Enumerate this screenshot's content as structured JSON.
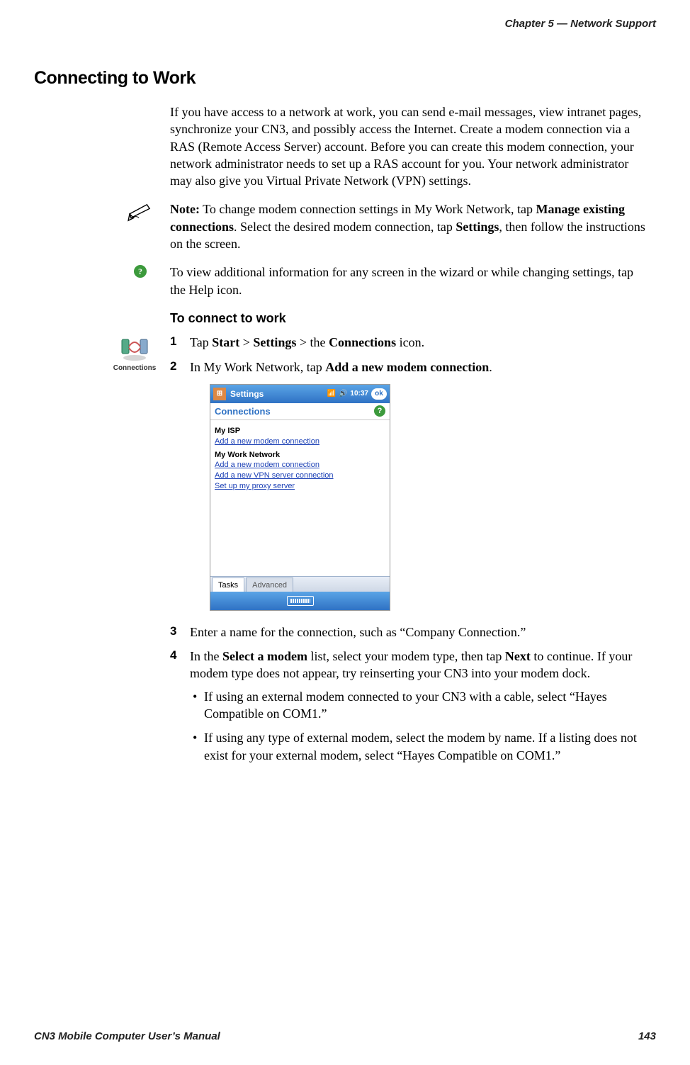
{
  "running_header": "Chapter 5 —  Network Support",
  "section_title": "Connecting to Work",
  "intro": "If you have access to a network at work, you can send e-mail messages, view intranet pages, synchronize your CN3, and possibly access the Internet. Create a modem connection via a RAS (Remote Access Server) account. Before you can create this modem connection, your network administrator needs to set up a RAS account for you. Your network administrator may also give you Virtual Private Network (VPN) settings.",
  "note": {
    "label": "Note:",
    "pre": " To change modem connection settings in My Work Network, tap ",
    "b1": "Manage existing connections",
    "mid": ". Select the desired modem connection, tap ",
    "b2": "Settings",
    "post": ", then follow the instructions on the screen."
  },
  "help_tip": "To view additional information for any screen in the wizard or while changing settings, tap the Help icon.",
  "proc_title": "To connect to work",
  "proc_icon_label": "Connections",
  "steps": {
    "s1": {
      "pre": "Tap ",
      "b1": "Start",
      "gt1": " > ",
      "b2": "Settings",
      "gt2": " > the ",
      "b3": "Connections",
      "post": " icon."
    },
    "s2": {
      "pre": "In My Work Network, tap ",
      "b1": "Add a new modem connection",
      "post": "."
    },
    "s3": "Enter a name for the connection, such as “Company Connection.”",
    "s4": {
      "pre": "In the ",
      "b1": "Select a modem",
      "mid": " list, select your modem type, then tap ",
      "b2": "Next",
      "post": " to continue. If your modem type does not appear, try reinserting your CN3 into your modem dock.",
      "bullets": [
        "If using an external modem connected to your CN3 with a cable, select “Hayes Compatible on COM1.”",
        "If using any type of external modem, select the modem by name. If a listing does not exist for your external modem, select “Hayes Compatible on COM1.”"
      ]
    }
  },
  "device": {
    "title": "Settings",
    "time": "10:37",
    "ok": "ok",
    "subhead": "Connections",
    "groups": [
      {
        "title": "My ISP",
        "links": [
          "Add a new modem connection"
        ]
      },
      {
        "title": "My Work Network",
        "links": [
          "Add a new modem connection",
          "Add a new VPN server connection",
          "Set up my proxy server"
        ]
      }
    ],
    "tabs": [
      "Tasks",
      "Advanced"
    ]
  },
  "footer": {
    "left": "CN3 Mobile Computer User’s Manual",
    "right": "143"
  }
}
